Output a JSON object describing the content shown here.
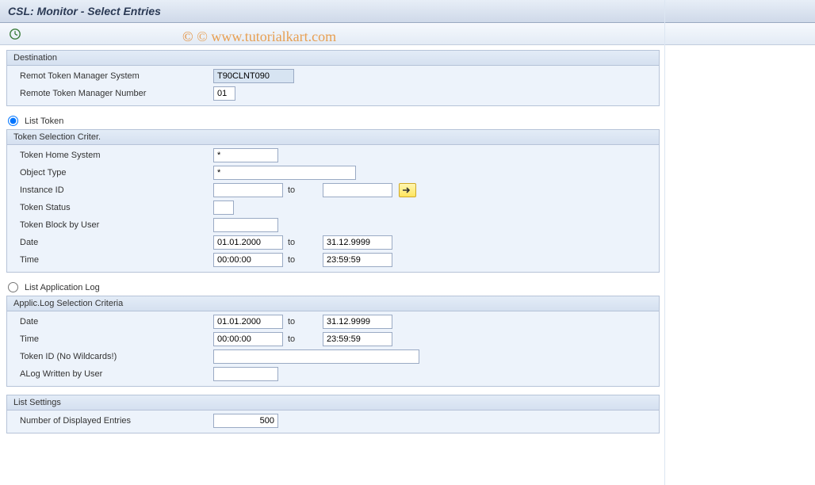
{
  "title": "CSL: Monitor - Select Entries",
  "watermark": "© www.tutorialkart.com",
  "toolbar": {
    "execute_tooltip": "Execute"
  },
  "destination": {
    "title": "Destination",
    "remote_system_label": "Remot Token Manager System",
    "remote_system_value": "T90CLNT090",
    "remote_number_label": "Remote Token Manager Number",
    "remote_number_value": "01"
  },
  "radio": {
    "list_token": "List Token",
    "list_applog": "List Application Log",
    "selected": "list_token"
  },
  "token_criteria": {
    "title": "Token Selection Criter.",
    "home_system_label": "Token Home System",
    "home_system_value": "*",
    "object_type_label": "Object Type",
    "object_type_value": "*",
    "instance_id_label": "Instance ID",
    "instance_id_from": "",
    "instance_id_to": "",
    "to_label": "to",
    "token_status_label": "Token Status",
    "token_status_value": "",
    "token_block_label": "Token Block by User",
    "token_block_value": "",
    "date_label": "Date",
    "date_from": "01.01.2000",
    "date_to": "31.12.9999",
    "time_label": "Time",
    "time_from": "00:00:00",
    "time_to": "23:59:59"
  },
  "applog_criteria": {
    "title": "Applic.Log Selection Criteria",
    "date_label": "Date",
    "date_from": "01.01.2000",
    "date_to": "31.12.9999",
    "to_label": "to",
    "time_label": "Time",
    "time_from": "00:00:00",
    "time_to": "23:59:59",
    "token_id_label": "Token ID (No Wildcards!)",
    "token_id_value": "",
    "alog_user_label": "ALog Written by User",
    "alog_user_value": ""
  },
  "list_settings": {
    "title": "List Settings",
    "num_entries_label": "Number of Displayed Entries",
    "num_entries_value": "500"
  }
}
